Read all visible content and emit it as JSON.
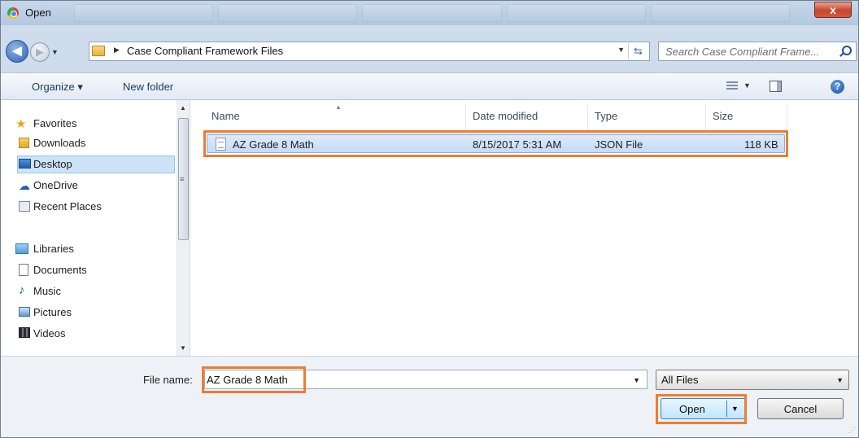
{
  "window": {
    "title": "Open",
    "close_label": "x"
  },
  "address": {
    "back_glyph": "◀",
    "forward_glyph": "▶",
    "breadcrumb": "Case Compliant Framework Files",
    "search_placeholder": "Search Case Compliant Frame..."
  },
  "toolbar": {
    "organize": "Organize ▾",
    "new_folder": "New folder",
    "help_glyph": "?"
  },
  "nav": {
    "favorites": [
      {
        "label": "Favorites",
        "icon": "star-icon"
      },
      {
        "label": "Downloads",
        "icon": "downloads-folder-icon"
      },
      {
        "label": "Desktop",
        "icon": "desktop-icon"
      },
      {
        "label": "OneDrive",
        "icon": "onedrive-icon"
      },
      {
        "label": "Recent Places",
        "icon": "recent-places-icon"
      }
    ],
    "libraries": [
      {
        "label": "Libraries",
        "icon": "libraries-icon"
      },
      {
        "label": "Documents",
        "icon": "documents-icon"
      },
      {
        "label": "Music",
        "icon": "music-icon"
      },
      {
        "label": "Pictures",
        "icon": "pictures-icon"
      },
      {
        "label": "Videos",
        "icon": "videos-icon"
      }
    ],
    "selected": "Desktop"
  },
  "filelist": {
    "columns": [
      "Name",
      "Date modified",
      "Type",
      "Size"
    ],
    "rows": [
      {
        "name": "AZ Grade 8 Math",
        "date": "8/15/2017 5:31 AM",
        "type": "JSON File",
        "size": "118 KB",
        "icon": "json-file-icon"
      }
    ]
  },
  "bottom": {
    "file_name_label": "File name:",
    "file_name_value": "AZ Grade 8 Math",
    "filter": "All Files",
    "open_label": "Open",
    "cancel_label": "Cancel"
  },
  "colors": {
    "highlight": "#ed7d31",
    "selection": "#c4dcf7",
    "chrome": "#cfdcec"
  }
}
